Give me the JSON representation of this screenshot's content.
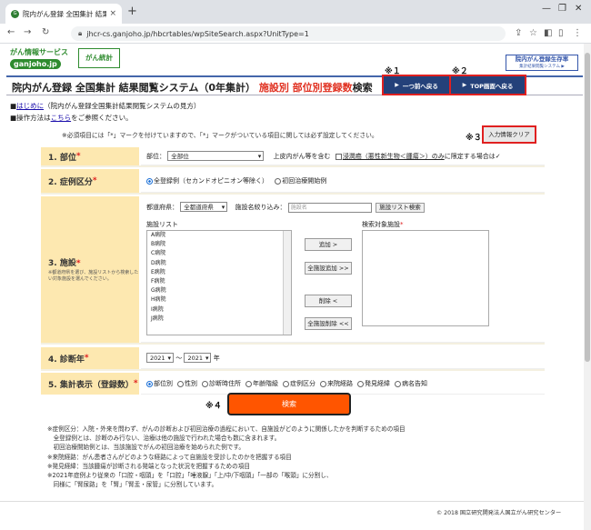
{
  "browser": {
    "tab_title": "院内がん登録 全国集計 結果閲覧",
    "url": "jhcr-cs.ganjoho.jp/hbcrtables/wpSiteSearch.aspx?UnitType=1"
  },
  "header": {
    "logo_top": "がん情報サービス",
    "logo_bottom": "ganjoho.jp",
    "logo2": "がん統計",
    "right_a": "院内がん登録生存率",
    "right_b": "集計結果閲覧システム ▶",
    "title": "院内がん登録 全国集計 結果閲覧システム（0年集計）",
    "title_red": "施設別 部位別登録数",
    "title_tail": "検索",
    "mark1": "※１",
    "mark2": "※２",
    "btn_back": "一つ前へ戻る",
    "btn_top": "TOP画面へ戻る"
  },
  "notes": {
    "l1_pre": "■",
    "l1_link": "はじめに",
    "l1_post": "（院内がん登録全国集計結果閲覧システムの見方）",
    "l2_pre": "■操作方法は",
    "l2_link": "こちら",
    "l2_post": "をご参照ください。",
    "required": "※必須項目には「*」マークを付けていますので、「*」マークがついている項目に関しては必ず設定してください。",
    "mark3": "※３",
    "clear": "入力情報クリア"
  },
  "form": {
    "r1_label": "1.  部位",
    "r1_site_label": "部位：",
    "r1_site_value": "全部位",
    "r1_mid": "上皮内がん等を含む",
    "r1_chk_label": "浸潤癌（悪性新生物＜腫瘍＞）のみ",
    "r1_tail": "に限定する場合は✓",
    "r2_label": "2.  症例区分",
    "r2_opt1": "全登録例（セカンドオピニオン等除く）",
    "r2_opt2": "初回治療開始例",
    "r3_label": "3.  施設",
    "r3_sub": "※都道府県を選び、施設リストから検索したい対象施設を選んでください。",
    "r3_pref_label": "都道府県：",
    "r3_pref_value": "全都道府県",
    "r3_narrow": "施設名絞り込み：",
    "r3_placeholder": "施設名",
    "r3_listbtn": "施設リスト検索",
    "r3_list_title": "施設リスト",
    "r3_target_title": "検索対象施設",
    "r3_items": [
      "A病院",
      "B病院",
      "C病院",
      "D病院",
      "E病院",
      "F病院",
      "G病院",
      "H病院",
      "I病院",
      "J病院"
    ],
    "r3_add": "追加 >",
    "r3_addall": "全施設追加 >>",
    "r3_del": "削除 <",
    "r3_delall": "全施設削除 <<",
    "r4_label": "4.  診断年",
    "r4_from": "2021",
    "r4_to": "2021",
    "r4_unit": "年",
    "r5_label": "5.  集計表示（登録数）",
    "r5_opts": [
      "部位別",
      "性別",
      "診断時住所",
      "年齢階級",
      "症例区分",
      "来院経路",
      "発見経緯",
      "病名告知"
    ]
  },
  "search": {
    "mark4": "※４",
    "label": "検索"
  },
  "footnotes": [
    "※症例区分：入院・外来を問わず、がんの診断および初回治療の過程において、自施設がどのように関係したかを判断するための項目",
    "　全登録例とは、診断のみ行ない、治療は他の施設で行われた場合も数に含まれます。",
    "　初回治療開始例とは、当該施設でがんの初回治療を始められた例です。",
    "※来院経路：がん患者さんがどのような経路によって自施設を受診したのかを把握する項目",
    "※発見経緯：当該腫瘍が診断される発端となった状況を把握するための項目",
    "※2021年症例より従来の「口腔・咽頭」を「口腔」「唾液腺」「上/中/下咽頭」「一部の「喉頭」に分割し、",
    "　同様に「腎尿路」を「腎」「腎盂・尿管」に分割しています。"
  ],
  "copyright": "© 2018 国立研究開発法人国立がん研究センター"
}
